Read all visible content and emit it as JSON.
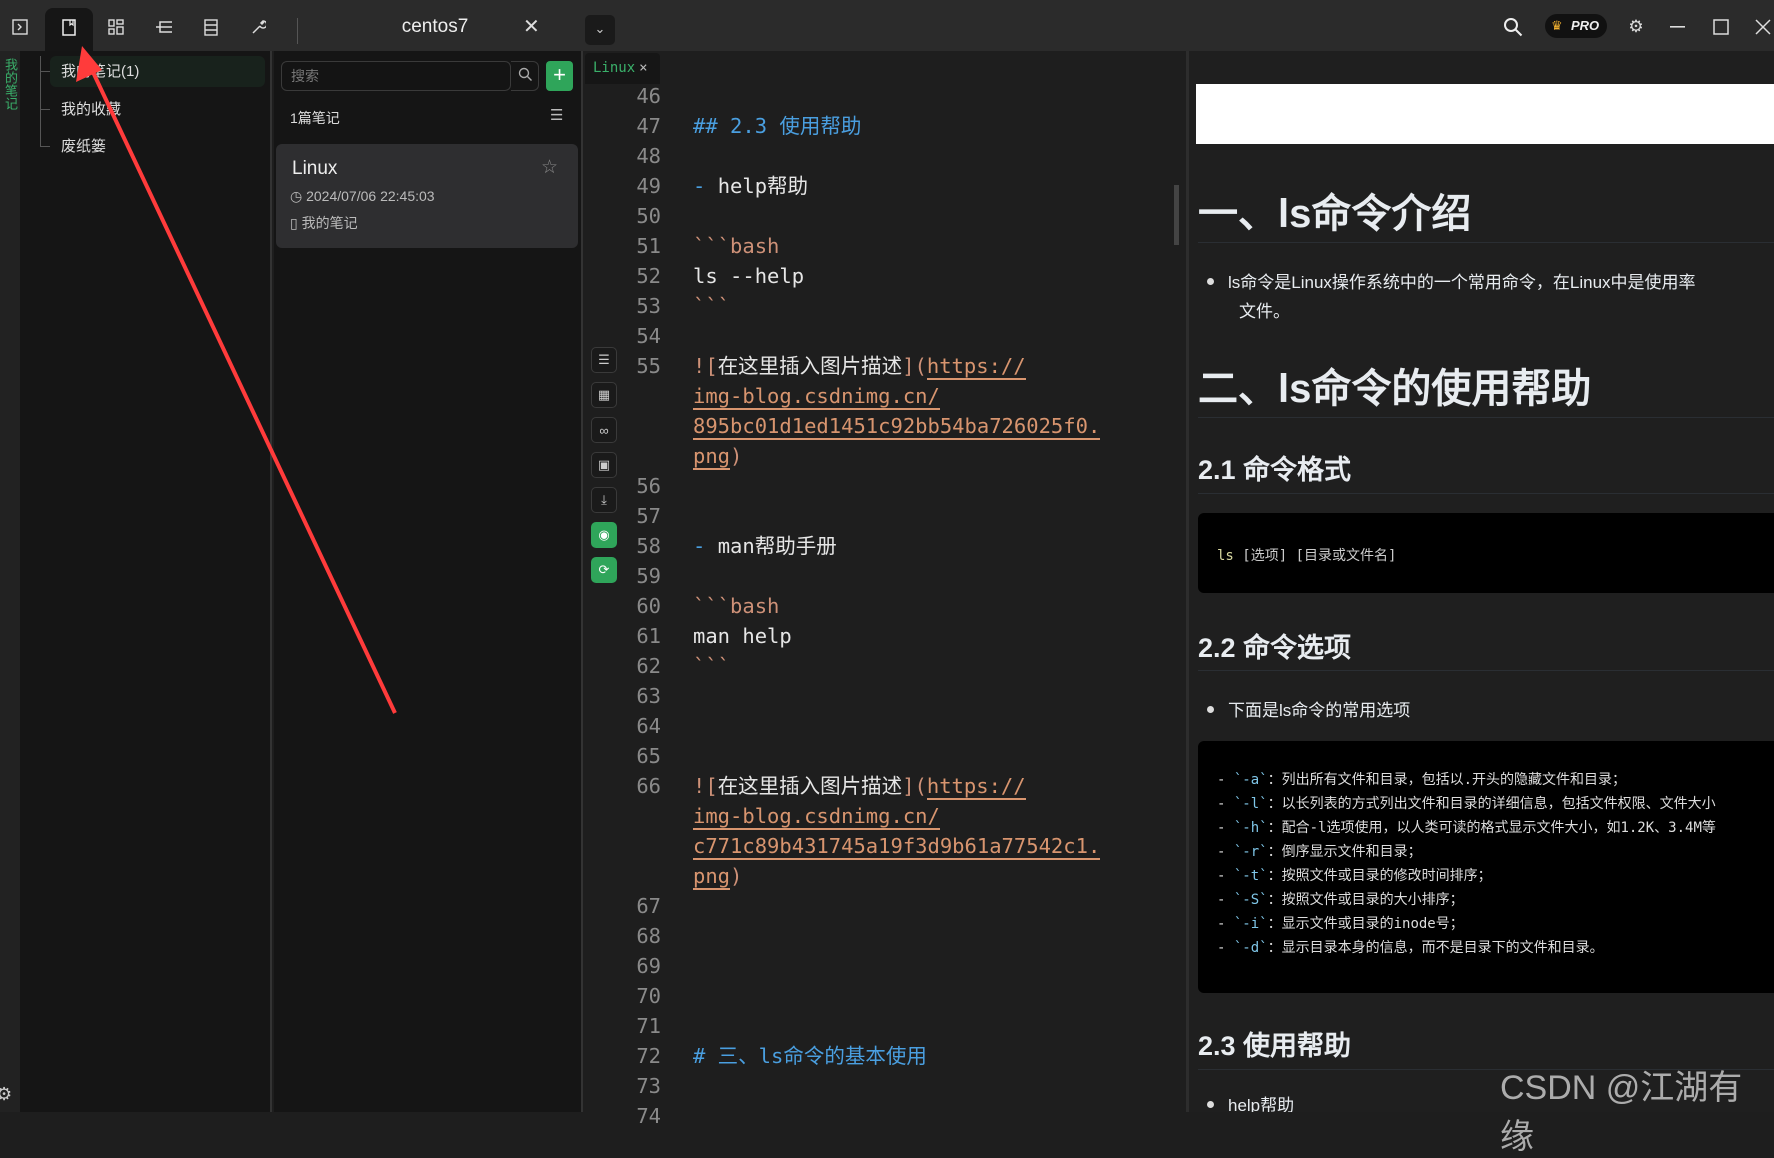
{
  "topbar": {
    "tab_title": "centos7",
    "close": "✕",
    "dropdown": "⌄",
    "pro_label": "PRO"
  },
  "sidebar": {
    "vertical_label": "我的笔记",
    "items": [
      {
        "label": "我的笔记(1)"
      },
      {
        "label": "我的收藏"
      },
      {
        "label": "废纸篓"
      }
    ]
  },
  "notes": {
    "search_placeholder": "搜索",
    "add": "+",
    "count": "1篇笔记",
    "card": {
      "title": "Linux",
      "date": "2024/07/06 22:45:03",
      "folder": "我的笔记"
    }
  },
  "editor": {
    "tab": "Linux",
    "tab_close": "×",
    "rows": [
      {
        "n": "46",
        "s": []
      },
      {
        "n": "47",
        "s": [
          {
            "t": "## 2.3 使用帮助",
            "c": "h"
          }
        ]
      },
      {
        "n": "48",
        "s": []
      },
      {
        "n": "49",
        "s": [
          {
            "t": "- ",
            "c": "dash"
          },
          {
            "t": "help帮助",
            "c": "t"
          }
        ]
      },
      {
        "n": "50",
        "s": []
      },
      {
        "n": "51",
        "s": [
          {
            "t": "```bash",
            "c": "o"
          }
        ]
      },
      {
        "n": "52",
        "s": [
          {
            "t": "ls --help",
            "c": "t"
          }
        ]
      },
      {
        "n": "53",
        "s": [
          {
            "t": "```",
            "c": "o"
          }
        ]
      },
      {
        "n": "54",
        "s": []
      },
      {
        "n": "55",
        "s": [
          {
            "t": "![",
            "c": "o"
          },
          {
            "t": "在这里插入图片描述",
            "c": "t"
          },
          {
            "t": "](",
            "c": "o"
          },
          {
            "t": "https://",
            "c": "u"
          }
        ]
      },
      {
        "n": "",
        "s": [
          {
            "t": "img-blog.csdnimg.cn/",
            "c": "u"
          }
        ]
      },
      {
        "n": "",
        "s": [
          {
            "t": "895bc01d1ed1451c92bb54ba726025f0.",
            "c": "u"
          }
        ]
      },
      {
        "n": "",
        "s": [
          {
            "t": "png",
            "c": "u"
          },
          {
            "t": ")",
            "c": "o"
          }
        ]
      },
      {
        "n": "56",
        "s": []
      },
      {
        "n": "57",
        "s": []
      },
      {
        "n": "58",
        "s": [
          {
            "t": "- ",
            "c": "dash"
          },
          {
            "t": "man帮助手册",
            "c": "t"
          }
        ]
      },
      {
        "n": "59",
        "s": []
      },
      {
        "n": "60",
        "s": [
          {
            "t": "```bash",
            "c": "o"
          }
        ]
      },
      {
        "n": "61",
        "s": [
          {
            "t": "man help",
            "c": "t"
          }
        ]
      },
      {
        "n": "62",
        "s": [
          {
            "t": "```",
            "c": "o"
          }
        ]
      },
      {
        "n": "63",
        "s": []
      },
      {
        "n": "64",
        "s": []
      },
      {
        "n": "65",
        "s": []
      },
      {
        "n": "66",
        "s": [
          {
            "t": "![",
            "c": "o"
          },
          {
            "t": "在这里插入图片描述",
            "c": "t"
          },
          {
            "t": "](",
            "c": "o"
          },
          {
            "t": "https://",
            "c": "u"
          }
        ]
      },
      {
        "n": "",
        "s": [
          {
            "t": "img-blog.csdnimg.cn/",
            "c": "u"
          }
        ]
      },
      {
        "n": "",
        "s": [
          {
            "t": "c771c89b431745a19f3d9b61a77542c1.",
            "c": "u"
          }
        ]
      },
      {
        "n": "",
        "s": [
          {
            "t": "png",
            "c": "u"
          },
          {
            "t": ")",
            "c": "o"
          }
        ]
      },
      {
        "n": "67",
        "s": []
      },
      {
        "n": "68",
        "s": []
      },
      {
        "n": "69",
        "s": []
      },
      {
        "n": "70",
        "s": []
      },
      {
        "n": "71",
        "s": []
      },
      {
        "n": "72",
        "s": [
          {
            "t": "# 三、ls命令的基本使用",
            "c": "h"
          }
        ]
      },
      {
        "n": "73",
        "s": []
      },
      {
        "n": "74",
        "s": []
      }
    ]
  },
  "preview": {
    "h1_intro": "一、ls命令介绍",
    "intro_bullet_1": "ls命令是Linux操作系统中的一个常用命令，在Linux中是使用率",
    "intro_bullet_2": "文件。",
    "h1_help": "二、ls命令的使用帮助",
    "h2_format": "2.1 命令格式",
    "format_code": {
      "cmd": "ls",
      "args": " [选项] [目录或文件名]"
    },
    "h2_options": "2.2 命令选项",
    "options_bullet": "下面是ls命令的常用选项",
    "options": {
      "dash": "- ",
      "tick": "`",
      "sep": "：",
      "items": [
        {
          "flag": "-a",
          "desc": "列出所有文件和目录，包括以.开头的隐藏文件和目录；"
        },
        {
          "flag": "-l",
          "desc": "以长列表的方式列出文件和目录的详细信息，包括文件权限、文件大小"
        },
        {
          "flag": "-h",
          "desc": "配合-l选项使用，以人类可读的格式显示文件大小，如1.2K、3.4M等"
        },
        {
          "flag": "-r",
          "desc": "倒序显示文件和目录；"
        },
        {
          "flag": "-t",
          "desc": "按照文件或目录的修改时间排序；"
        },
        {
          "flag": "-S",
          "desc": "按照文件或目录的大小排序；"
        },
        {
          "flag": "-i",
          "desc": "显示文件或目录的inode号；"
        },
        {
          "flag": "-d",
          "desc": "显示目录本身的信息，而不是目录下的文件和目录。"
        }
      ]
    },
    "h2_usage": "2.3 使用帮助",
    "usage_bullet": "help帮助"
  },
  "watermark": "CSDN @江湖有缘",
  "colors": {
    "accent": "#2fa55a",
    "arrow": "#ff3b3b"
  }
}
